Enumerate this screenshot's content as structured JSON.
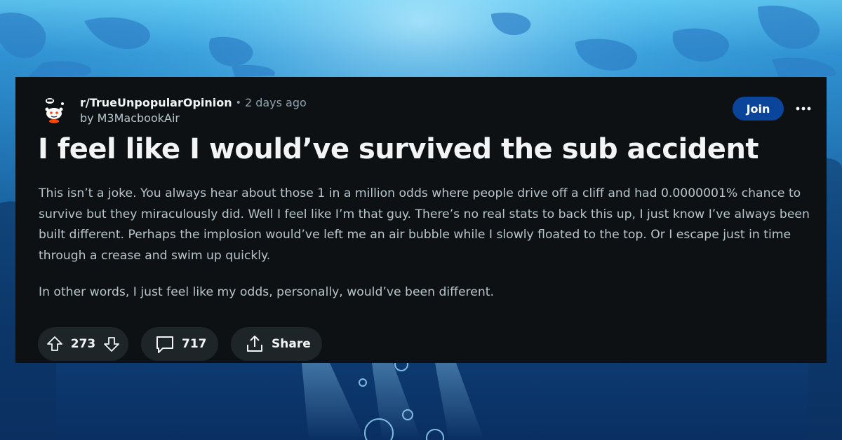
{
  "post": {
    "subreddit": "r/TrueUnpopularOpinion",
    "separator": "•",
    "time_ago": "2 days ago",
    "by_prefix": "by",
    "author": "M3MacbookAir",
    "title": "I feel like I would’ve survived the sub accident",
    "body": [
      "This isn’t a joke. You always hear about those 1 in a million odds where people drive off a cliff and had 0.0000001% chance to survive but they miraculously did. Well I feel like I’m that guy. There’s no real stats to back this up, I just know I’ve always been built different. Perhaps the implosion would’ve left me an air bubble while I slowly floated to the top. Or I escape just in time through a crease and swim up quickly.",
      "In other words, I just feel like my odds, personally, would’ve been different."
    ]
  },
  "header": {
    "join_label": "Join",
    "more_icon": "more-options-icon"
  },
  "actions": {
    "upvote_icon": "upvote-arrow-icon",
    "vote_count": "273",
    "downvote_icon": "downvote-arrow-icon",
    "comment_icon": "comment-bubble-icon",
    "comment_count": "717",
    "share_icon": "share-icon",
    "share_label": "Share"
  },
  "colors": {
    "card_background": "#0e1113",
    "join_button": "#0a449b",
    "pill_background": "#1e2529",
    "body_text": "#b7c5cc",
    "title_text": "#f2f4f5",
    "background_ocean_top": "#5ec8f2",
    "background_ocean_bottom": "#0a2f62"
  }
}
